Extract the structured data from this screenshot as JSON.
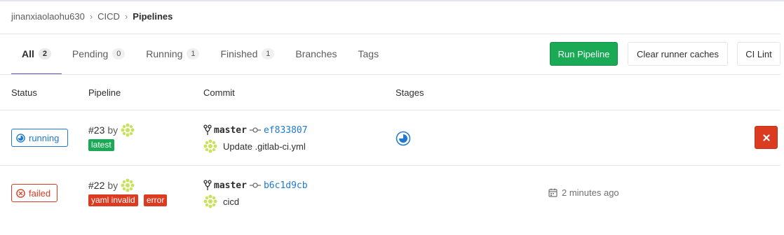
{
  "breadcrumb": {
    "items": [
      "jinanxiaolaohu630",
      "CICD",
      "Pipelines"
    ]
  },
  "tabs": [
    {
      "label": "All",
      "count": "2",
      "active": true
    },
    {
      "label": "Pending",
      "count": "0"
    },
    {
      "label": "Running",
      "count": "1"
    },
    {
      "label": "Finished",
      "count": "1"
    },
    {
      "label": "Branches"
    },
    {
      "label": "Tags"
    }
  ],
  "actions": {
    "run_pipeline": "Run Pipeline",
    "clear_caches": "Clear runner caches",
    "ci_lint": "CI Lint"
  },
  "columns": {
    "status": "Status",
    "pipeline": "Pipeline",
    "commit": "Commit",
    "stages": "Stages"
  },
  "pipelines": [
    {
      "status": "running",
      "id": "#23",
      "by": "by",
      "labels": [
        "latest"
      ],
      "branch": "master",
      "sha": "ef833807",
      "message": "Update .gitlab-ci.yml",
      "stage_status": "running"
    },
    {
      "status": "failed",
      "id": "#22",
      "by": "by",
      "labels": [
        "yaml invalid",
        "error"
      ],
      "branch": "master",
      "sha": "b6c1d9cb",
      "message": "cicd",
      "time": "2 minutes ago"
    }
  ],
  "colors": {
    "accent_tab": "#6b4fbb",
    "success": "#1aaa55",
    "running": "#1f78d1",
    "failed": "#db3b21"
  }
}
